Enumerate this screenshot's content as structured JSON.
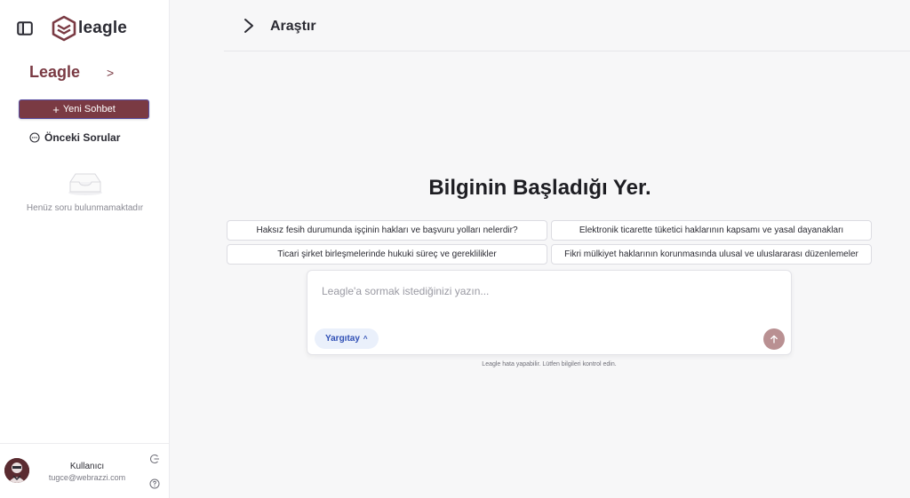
{
  "sidebar": {
    "logo_text": "leagle",
    "brand_name": "Leagle",
    "brand_chevron": ">",
    "new_chat_label": "Yeni Sohbet",
    "new_chat_plus": "+",
    "previous_questions_label": "Önceki Sorular",
    "empty_text": "Henüz soru bulunmamaktadır"
  },
  "user": {
    "name": "Kullanıcı",
    "email": "tugce@webrazzi.com"
  },
  "header": {
    "title": "Araştır"
  },
  "main": {
    "hero_title": "Bilginin Başladığı Yer.",
    "suggestions": [
      "Haksız fesih durumunda işçinin hakları ve başvuru yolları nelerdir?",
      "Elektronik ticarette tüketici haklarının kapsamı ve yasal dayanakları",
      "Ticari şirket birleşmelerinde hukuki süreç ve gereklilikler",
      "Fikri mülkiyet haklarının korunmasında ulusal ve uluslararası düzenlemeler"
    ],
    "input_placeholder": "Leagle'a sormak istediğinizi yazın...",
    "source_label": "Yargıtay",
    "source_caret": "^",
    "disclaimer": "Leagle hata yapabilir. Lütfen bilgileri kontrol edin."
  },
  "colors": {
    "brand": "#7a3a43",
    "send_button": "#b99092",
    "source_pill_bg": "#eaf0fb",
    "source_pill_text": "#2f4fb5"
  },
  "icons": [
    "panel-toggle-icon",
    "leagle-logo-icon",
    "chat-bubble-icon",
    "empty-inbox-icon",
    "logout-icon",
    "help-icon",
    "chevron-right-icon",
    "arrow-up-icon"
  ]
}
